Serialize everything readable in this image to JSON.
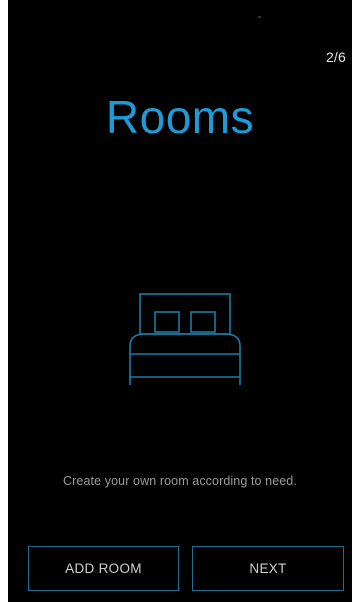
{
  "header": {
    "page_counter": "2/6"
  },
  "onboarding": {
    "title": "Rooms",
    "icon": "bed-icon",
    "description": "Create your own room according to need."
  },
  "actions": {
    "add_room_label": "ADD ROOM",
    "next_label": "NEXT"
  },
  "colors": {
    "background": "#000000",
    "accent": "#1e9ad6",
    "button_border": "#1d6f93"
  }
}
